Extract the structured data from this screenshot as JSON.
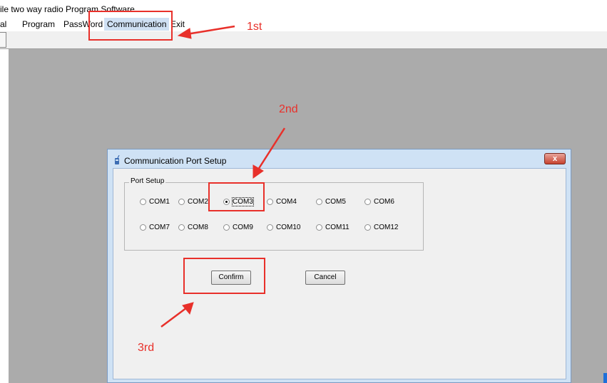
{
  "window": {
    "title": "ile two way radio Program Software."
  },
  "menu": {
    "items": [
      {
        "label": "al"
      },
      {
        "label": "Program"
      },
      {
        "label": "PassWord"
      },
      {
        "label": "Communication",
        "highlighted": true
      },
      {
        "label": "Exit"
      }
    ]
  },
  "dialog": {
    "title": "Communication Port Setup",
    "close_label": "x",
    "group_label": "Port Setup",
    "ports": [
      {
        "label": "COM1",
        "selected": false
      },
      {
        "label": "COM2",
        "selected": false
      },
      {
        "label": "COM3",
        "selected": true
      },
      {
        "label": "COM4",
        "selected": false
      },
      {
        "label": "COM5",
        "selected": false
      },
      {
        "label": "COM6",
        "selected": false
      },
      {
        "label": "COM7",
        "selected": false
      },
      {
        "label": "COM8",
        "selected": false
      },
      {
        "label": "COM9",
        "selected": false
      },
      {
        "label": "COM10",
        "selected": false
      },
      {
        "label": "COM11",
        "selected": false
      },
      {
        "label": "COM12",
        "selected": false
      }
    ],
    "confirm_label": "Confirm",
    "cancel_label": "Cancel"
  },
  "annotations": {
    "step1": "1st",
    "step2": "2nd",
    "step3": "3rd",
    "color": "#e8302a"
  }
}
